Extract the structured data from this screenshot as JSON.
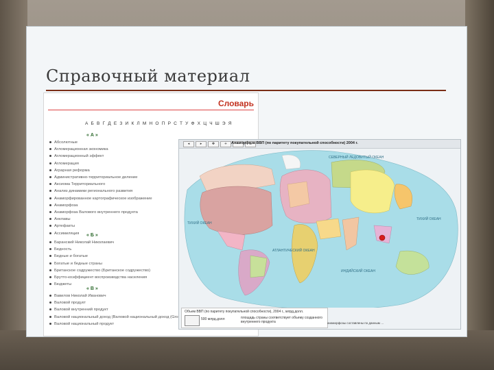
{
  "slide": {
    "title": "Справочный материал"
  },
  "dictionary": {
    "header": "Словарь",
    "alphabet": "А Б В Г Д Е З И К Л М Н О П Р С Т У Ф Х Ц Ч Ш Э Я",
    "section_a": "« А »",
    "items_a": [
      "Абсолютные",
      "Агломерационная экономика",
      "Агломерационный эффект",
      "Агломерация",
      "Аграрная реформа",
      "Административно-территориальное деление",
      "Аксиома Территориального",
      "Анализ динамики регионального развития",
      "Анаморфированное картографическое изображение",
      "Анаморфоза",
      "Анаморфоза Валового внутреннего продукта",
      "Анклавы",
      "Артефакты",
      "Ассимиляция"
    ],
    "section_b": "« Б »",
    "items_b": [
      "Баранский Николай Николаевич",
      "Бедность",
      "Бедные и богатые",
      "Богатые и бедные страны",
      "Британское содружество (Британское содружество)",
      "Брутто-коэффициент воспроизводства населения",
      "Бюджеты"
    ],
    "section_v": "« В »",
    "items_v": [
      "Вавилов Николай Иванович",
      "Валовой продукт",
      "Валовой внутренний продукт",
      "Валовой национальный доход (Валовой национальный доход (Gross National Income))",
      "Валовой национальный продукт"
    ]
  },
  "map": {
    "caption": "Анаморфоза ВВП (по паритету покупательной способности) 2004 г.",
    "tools": [
      "◂",
      "▸",
      "✥",
      "+",
      "−",
      "⌂"
    ],
    "legend_title": "Объем ВВП (по паритету покупательной способности), 2004 г., млрд.долл.",
    "legend_value": "500 млрд.долл",
    "legend_note": "площадь страны соответствует объему созданного внутреннего продукта",
    "credit": "анаморфозы составлены по данным …",
    "labels": [
      "СЕВЕРНЫЙ ЛЕДОВИТЫЙ ОКЕАН",
      "ТИХИЙ ОКЕАН",
      "АТЛАНТИЧЕСКИЙ ОКЕАН",
      "ИНДИЙСКИЙ ОКЕАН",
      "ТИХИЙ ОКЕАН"
    ],
    "colors": {
      "ocean": "#a9dde8",
      "usa": "#d9a3a1",
      "china": "#f6ee8b",
      "russia": "#c5d98a",
      "europe": "#e7b3c3"
    }
  }
}
